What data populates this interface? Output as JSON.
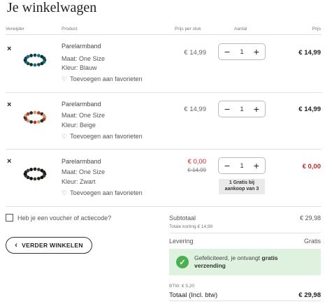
{
  "page": {
    "title": "Je winkelwagen"
  },
  "header": {
    "remove": "Verwijder",
    "product": "Product",
    "unit_price": "Prijs per stuk",
    "quantity": "Aantal",
    "price": "Prijs"
  },
  "items": [
    {
      "remove_icon": "×",
      "name": "Parelarmband",
      "size": "Maat: One Size",
      "color": "Kleur: Blauw",
      "favorite": "Toevoegen aan favorieten",
      "unit_price": "€ 14,99",
      "qty": "1",
      "minus": "−",
      "plus": "+",
      "total": "€ 14,99",
      "bead_colors": [
        "#0e4a55",
        "#1b6c75",
        "#0a2f36"
      ]
    },
    {
      "remove_icon": "×",
      "name": "Parelarmband",
      "size": "Maat: One Size",
      "color": "Kleur: Beige",
      "favorite": "Toevoegen aan favorieten",
      "unit_price": "€ 14,99",
      "qty": "1",
      "minus": "−",
      "plus": "+",
      "total": "€ 14,99",
      "bead_colors": [
        "#c9a074",
        "#b03b2a",
        "#2b2b2b"
      ]
    },
    {
      "remove_icon": "×",
      "name": "Parelarmband",
      "size": "Maat: One Size",
      "color": "Kleur: Zwart",
      "favorite": "Toevoegen aan favorieten",
      "unit_price": "€ 0,00",
      "old_price": "€ 14,99",
      "qty": "1",
      "minus": "−",
      "plus": "+",
      "total": "€ 0,00",
      "promo": "1 Gratis bij aankoop van 3",
      "bead_colors": [
        "#222222",
        "#4a3a2a",
        "#111111"
      ]
    }
  ],
  "voucher": {
    "label": "Heb je een voucher of actiecode?"
  },
  "continue_button": {
    "label": "VERDER WINKELEN"
  },
  "summary": {
    "subtotal_label": "Subtotaal",
    "subtotal_value": "€ 29,98",
    "discount_label": "Totale korting € 14,99",
    "delivery_label": "Levering",
    "delivery_value": "Gratis",
    "shipping_msg_1": "Gefeliciteerd, je ontvangt ",
    "shipping_msg_bold_a": "gratis",
    "shipping_msg_bold_b": "verzending",
    "btw": "BTW: € 5,20",
    "total_label": "Totaal (Incl. btw)",
    "total_value": "€ 29,98"
  },
  "colors": {
    "accent_red": "#c0272d",
    "success_green": "#4caf50",
    "success_bg": "#dff2e0"
  },
  "icons": {
    "remove": "close-icon",
    "favorite": "heart-icon",
    "voucher": "checkbox-icon",
    "continue": "chevron-left-icon",
    "success": "check-circle-icon"
  }
}
